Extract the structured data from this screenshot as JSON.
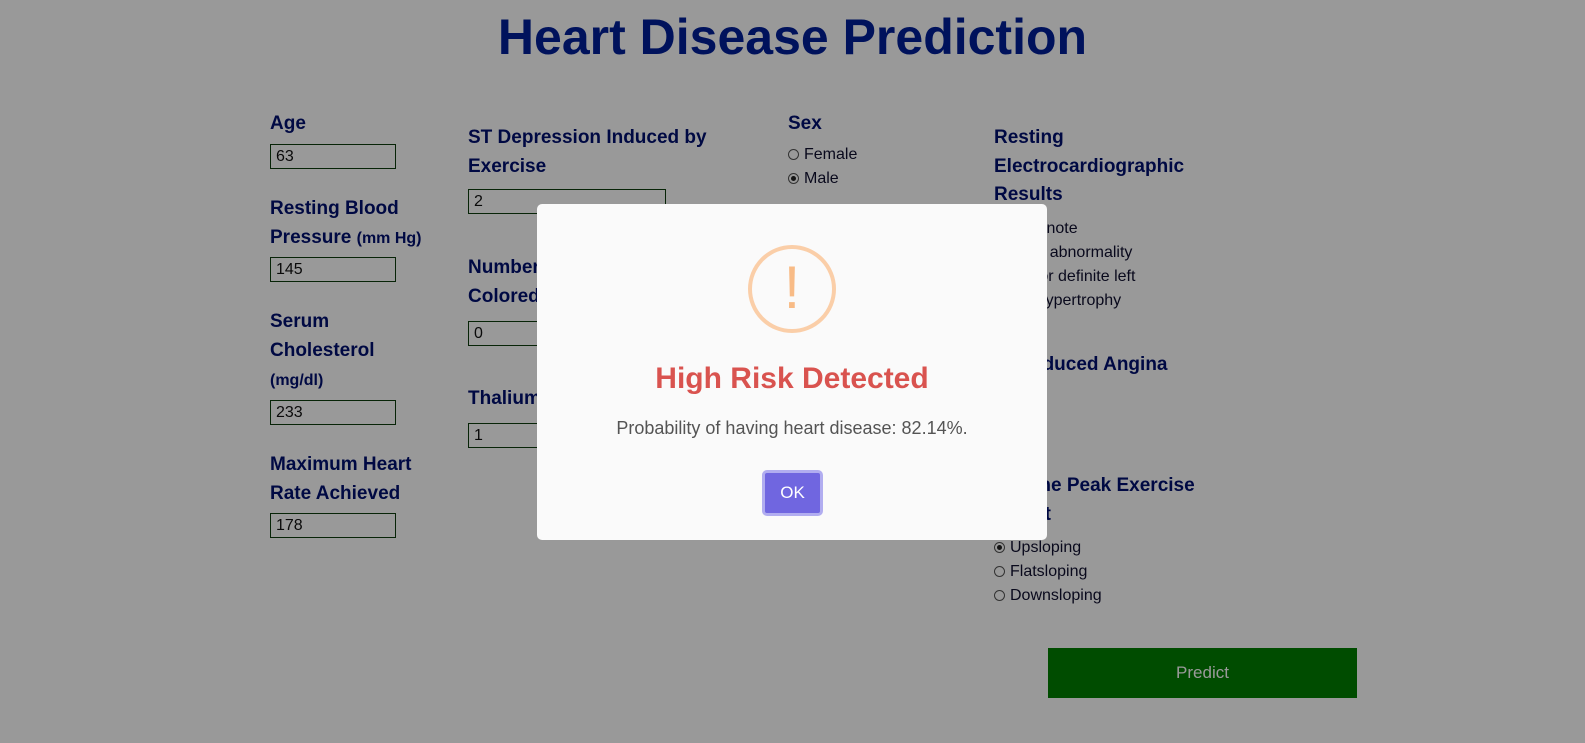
{
  "page": {
    "title": "Heart Disease Prediction"
  },
  "form": {
    "age": {
      "label": "Age",
      "value": "63"
    },
    "bp": {
      "label": "Resting Blood Pressure",
      "unit": "(mm Hg)",
      "value": "145"
    },
    "chol": {
      "label_1": "Serum",
      "label_2": "Cholesterol",
      "unit": "(mg/dl)",
      "value": "233"
    },
    "max_hr": {
      "label": "Maximum Heart Rate Achieved",
      "value": "178"
    },
    "st_depression": {
      "label": "ST Depression Induced by Exercise",
      "value": "2"
    },
    "vessels": {
      "label_partial": "Number",
      "label_partial_2": "Colored",
      "value": "0"
    },
    "thalium": {
      "label_partial": "Thalium",
      "value": "1"
    },
    "sex": {
      "label": "Sex",
      "options": [
        "Female",
        "Male"
      ],
      "selected": "Male"
    },
    "ecg": {
      "label_1": "Resting",
      "label_2": "Electrocardiographic",
      "label_3": "Results",
      "options_visible": [
        "hing to note",
        "T wave abnormality",
        "ssible or definite left",
        "icular hypertrophy"
      ]
    },
    "angina": {
      "label_partial": "ise Induced Angina"
    },
    "slope": {
      "label_partial_1": "e of the Peak Exercise",
      "label_partial_2": "gment",
      "options": [
        "Upsloping",
        "Flatsloping",
        "Downsloping"
      ],
      "selected": "Upsloping"
    },
    "predict_label": "Predict"
  },
  "dialog": {
    "icon": "warning-icon",
    "icon_glyph": "!",
    "title": "High Risk Detected",
    "message": "Probability of having heart disease: 82.14%.",
    "ok_label": "OK"
  },
  "colors": {
    "title": "#001f9a",
    "predict": "#007f00",
    "dialog_title": "#d9534f",
    "ok_button": "#7066e0",
    "warning": "#f8bb86"
  }
}
